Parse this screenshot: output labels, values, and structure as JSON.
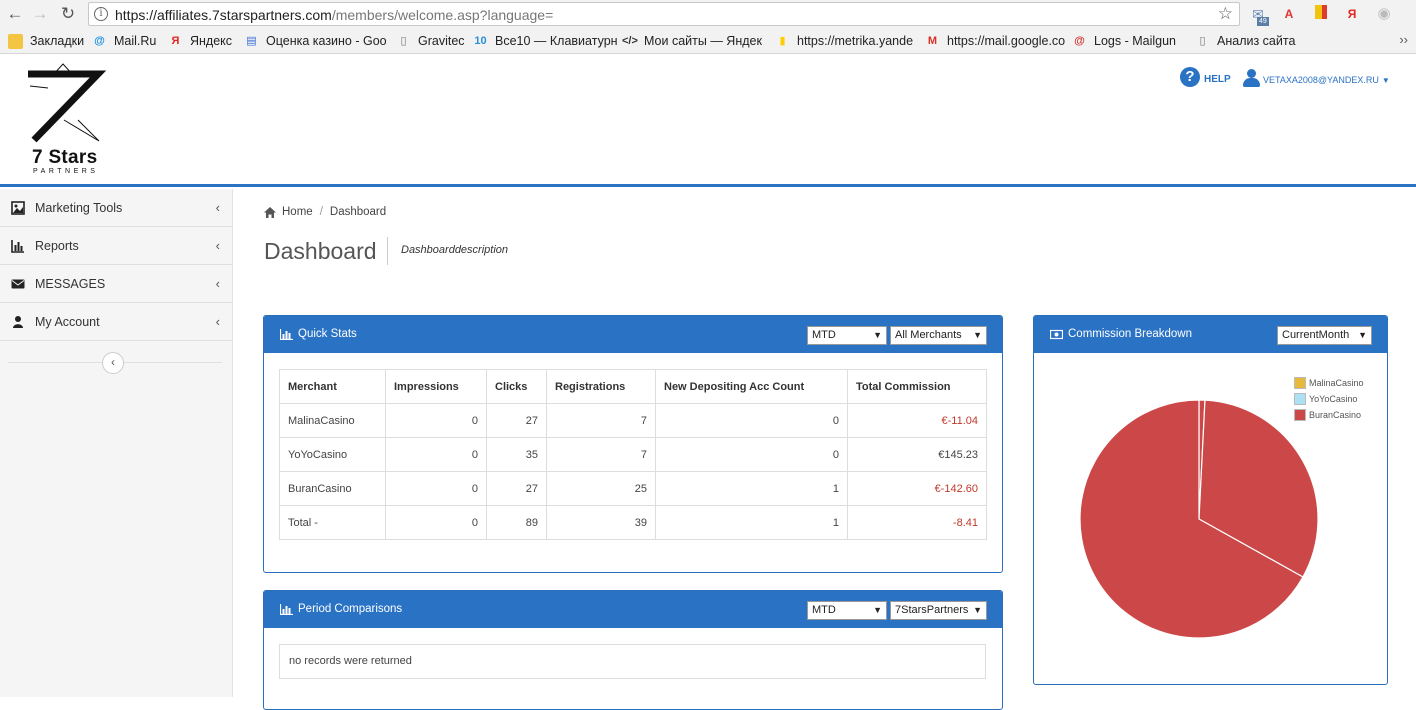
{
  "browser": {
    "url_host": "https://affiliates.7starspartners.com",
    "url_path": "/members/welcome.asp?language=",
    "ext_badge": "49",
    "bookmarks": [
      {
        "label": "Закладки",
        "icon": "folder-icon",
        "color": "#f4c542"
      },
      {
        "label": "Mail.Ru",
        "icon": "mailru-icon",
        "color": "#168de2"
      },
      {
        "label": "Яндекс",
        "icon": "yandex-icon",
        "color": "#e52620"
      },
      {
        "label": "Оценка казино - Goo",
        "icon": "docs-icon",
        "color": "#3b6fd8"
      },
      {
        "label": "Gravitec",
        "icon": "page-icon",
        "color": "#777777"
      },
      {
        "label": "Все10 — Клавиатурн",
        "icon": "vse10-icon",
        "color": "#2a8fd6"
      },
      {
        "label": "Мои сайты — Яндек",
        "icon": "code-icon",
        "color": "#333333"
      },
      {
        "label": "https://metrika.yande",
        "icon": "metrika-icon",
        "color": "#ffcc00"
      },
      {
        "label": "https://mail.google.co",
        "icon": "gmail-icon",
        "color": "#d93025"
      },
      {
        "label": "Logs - Mailgun",
        "icon": "mailgun-icon",
        "color": "#d63333"
      },
      {
        "label": "Анализ сайта",
        "icon": "page-icon",
        "color": "#777777"
      }
    ]
  },
  "header": {
    "logo_title": "7 Stars",
    "logo_sub": "PARTNERS",
    "help_label": "HELP",
    "user_label": "VETAXA2008@YANDEX.RU"
  },
  "sidebar": {
    "items": [
      {
        "label": "Marketing Tools",
        "icon": "image-icon"
      },
      {
        "label": "Reports",
        "icon": "bar-chart-icon"
      },
      {
        "label": "MESSAGES",
        "icon": "envelope-icon"
      },
      {
        "label": "My Account",
        "icon": "user-icon"
      }
    ]
  },
  "breadcrumb": {
    "home": "Home",
    "current": "Dashboard"
  },
  "page": {
    "title": "Dashboard",
    "description": "Dashboarddescription"
  },
  "quick_stats": {
    "title": "Quick Stats",
    "period": "MTD",
    "merchant_filter": "All Merchants",
    "columns": [
      "Merchant",
      "Impressions",
      "Clicks",
      "Registrations",
      "New Depositing Acc Count",
      "Total Commission"
    ],
    "rows": [
      {
        "merchant": "MalinaCasino",
        "impressions": "0",
        "clicks": "27",
        "registrations": "7",
        "depositing": "0",
        "commission": "€-11.04"
      },
      {
        "merchant": "YoYoCasino",
        "impressions": "0",
        "clicks": "35",
        "registrations": "7",
        "depositing": "0",
        "commission": "€145.23"
      },
      {
        "merchant": "BuranCasino",
        "impressions": "0",
        "clicks": "27",
        "registrations": "25",
        "depositing": "1",
        "commission": "€-142.60"
      },
      {
        "merchant": "Total -",
        "impressions": "0",
        "clicks": "89",
        "registrations": "39",
        "depositing": "1",
        "commission": "-8.41"
      }
    ]
  },
  "period_comparisons": {
    "title": "Period Comparisons",
    "period": "MTD",
    "merchant_filter": "7StarsPartners",
    "empty_text": "no records were returned"
  },
  "commission_breakdown": {
    "title": "Commission Breakdown",
    "period": "CurrentMonth"
  },
  "chart_data": {
    "type": "pie",
    "title": "",
    "categories": [
      "MalinaCasino",
      "YoYoCasino",
      "BuranCasino"
    ],
    "values": [
      0.008,
      0.323,
      0.669
    ],
    "colors": [
      "#e6b93a",
      "#aee0f4",
      "#cc4747"
    ],
    "slice_fill": "#cc4747",
    "legend": "top-right"
  },
  "colors": {
    "accent": "#2a72c4",
    "negative": "#c0392b"
  }
}
